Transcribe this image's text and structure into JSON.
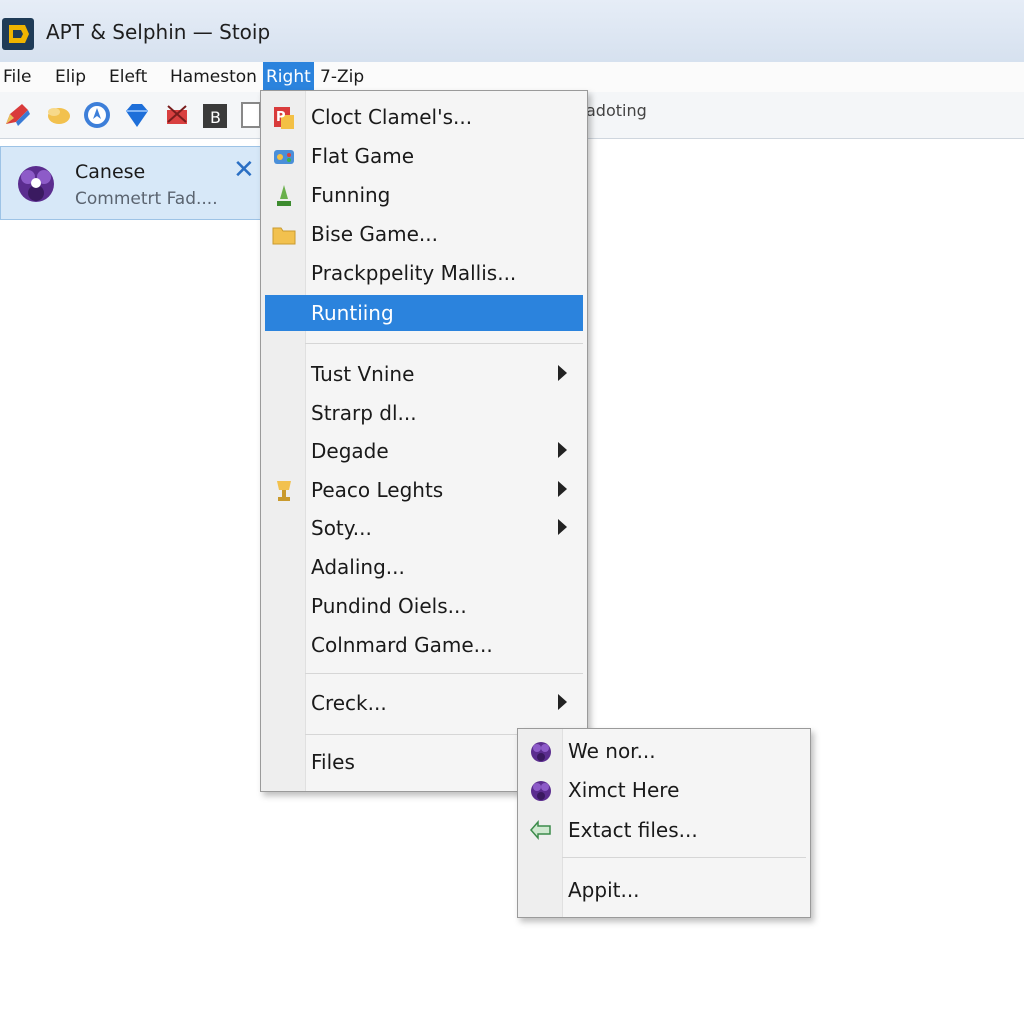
{
  "window": {
    "title": "APT & Selphin — Stoip"
  },
  "menubar": {
    "items": [
      {
        "label": "File"
      },
      {
        "label": "Elip"
      },
      {
        "label": "Eleft"
      },
      {
        "label": "Hameston"
      },
      {
        "label": "Right",
        "active": true
      },
      {
        "label": "7-Zip"
      }
    ]
  },
  "toolbar": {
    "status_label": "adoting"
  },
  "card": {
    "title": "Canese",
    "subtitle": "Commetrt Fad....",
    "close": "✕"
  },
  "context_menu": {
    "items": [
      {
        "label": "Cloct Clamel's...",
        "icon": "p-document-icon"
      },
      {
        "label": "Flat Game",
        "icon": "game-icon"
      },
      {
        "label": "Funning",
        "icon": "green-arrow-icon"
      },
      {
        "label": "Bise Game...",
        "icon": "folder-icon"
      },
      {
        "label": "Prackppelity Mallis..."
      },
      {
        "label": "Runtiing",
        "selected": true
      },
      {
        "label": "Tust Vnine",
        "submenu": true
      },
      {
        "label": "Strarp dl..."
      },
      {
        "label": "Degade",
        "submenu": true
      },
      {
        "label": "Peaco Leghts",
        "icon": "trophy-icon",
        "submenu": true
      },
      {
        "label": "Soty...",
        "submenu": true
      },
      {
        "label": "Adaling..."
      },
      {
        "label": "Pundind Oiels..."
      },
      {
        "label": "Colnmard Game..."
      },
      {
        "label": "Creck...",
        "submenu": true
      },
      {
        "label": "Files"
      }
    ]
  },
  "submenu": {
    "items": [
      {
        "label": "We nor...",
        "icon": "purple-archive-icon"
      },
      {
        "label": "Ximct Here",
        "icon": "purple-archive-icon"
      },
      {
        "label": "Extact files...",
        "icon": "extract-arrow-icon"
      },
      {
        "label": "Appit..."
      }
    ]
  },
  "colors": {
    "accent": "#2b83dd",
    "menu_bg": "#f5f5f5",
    "card_bg": "#d7e8f8"
  }
}
